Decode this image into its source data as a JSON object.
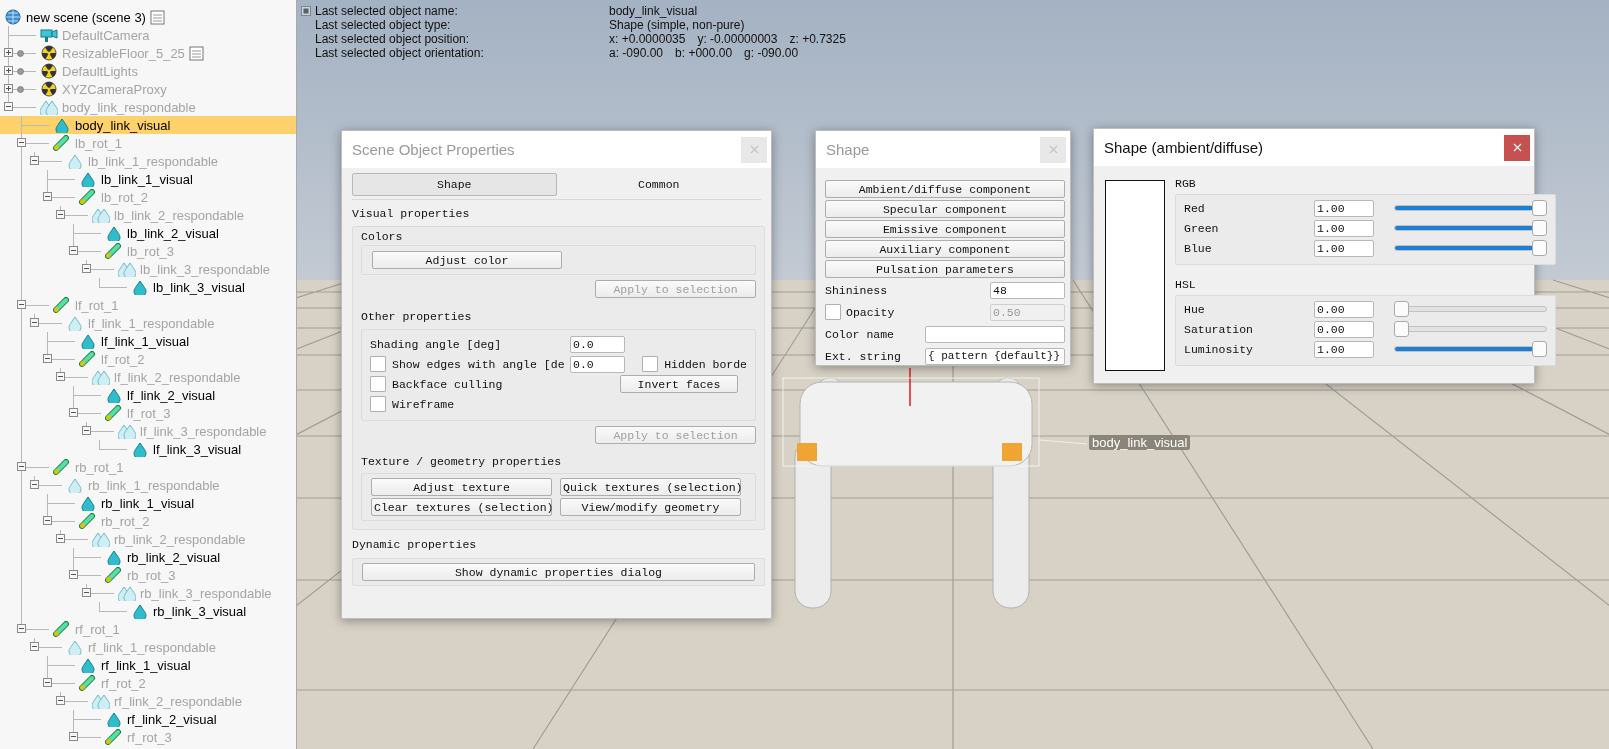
{
  "hierarchy": {
    "items": [
      {
        "label": "new scene (scene 3)",
        "kind": "scene",
        "dim": false,
        "selected": false,
        "has_script": true,
        "children": [
          {
            "label": "DefaultCamera",
            "kind": "camera",
            "dim": true,
            "selected": false
          },
          {
            "label": "ResizableFloor_5_25",
            "kind": "model",
            "dim": true,
            "selected": false,
            "has_script": true,
            "expanded": false
          },
          {
            "label": "DefaultLights",
            "kind": "model",
            "dim": true,
            "selected": false,
            "expanded": false
          },
          {
            "label": "XYZCameraProxy",
            "kind": "model",
            "dim": true,
            "selected": false,
            "expanded": false
          },
          {
            "label": "body_link_respondable",
            "kind": "multi_respondable",
            "dim": true,
            "selected": false,
            "expanded": true,
            "children": [
              {
                "label": "body_link_visual",
                "kind": "shape",
                "dim": false,
                "selected": true
              },
              {
                "label": "lb_rot_1",
                "kind": "joint",
                "dim": true,
                "selected": false,
                "expanded": true,
                "children": [
                  {
                    "label": "lb_link_1_respondable",
                    "kind": "respondable",
                    "dim": true,
                    "selected": false,
                    "expanded": true,
                    "children": [
                      {
                        "label": "lb_link_1_visual",
                        "kind": "shape",
                        "dim": false,
                        "selected": false
                      },
                      {
                        "label": "lb_rot_2",
                        "kind": "joint",
                        "dim": true,
                        "selected": false,
                        "expanded": true,
                        "children": [
                          {
                            "label": "lb_link_2_respondable",
                            "kind": "multi_respondable",
                            "dim": true,
                            "selected": false,
                            "expanded": true,
                            "children": [
                              {
                                "label": "lb_link_2_visual",
                                "kind": "shape",
                                "dim": false,
                                "selected": false
                              },
                              {
                                "label": "lb_rot_3",
                                "kind": "joint",
                                "dim": true,
                                "selected": false,
                                "expanded": true,
                                "children": [
                                  {
                                    "label": "lb_link_3_respondable",
                                    "kind": "multi_respondable",
                                    "dim": true,
                                    "selected": false,
                                    "expanded": true,
                                    "children": [
                                      {
                                        "label": "lb_link_3_visual",
                                        "kind": "shape",
                                        "dim": false,
                                        "selected": false
                                      }
                                    ]
                                  }
                                ]
                              }
                            ]
                          }
                        ]
                      }
                    ]
                  }
                ]
              },
              {
                "label": "lf_rot_1",
                "kind": "joint",
                "dim": true,
                "selected": false,
                "expanded": true,
                "children": [
                  {
                    "label": "lf_link_1_respondable",
                    "kind": "respondable",
                    "dim": true,
                    "selected": false,
                    "expanded": true,
                    "children": [
                      {
                        "label": "lf_link_1_visual",
                        "kind": "shape",
                        "dim": false,
                        "selected": false
                      },
                      {
                        "label": "lf_rot_2",
                        "kind": "joint",
                        "dim": true,
                        "selected": false,
                        "expanded": true,
                        "children": [
                          {
                            "label": "lf_link_2_respondable",
                            "kind": "multi_respondable",
                            "dim": true,
                            "selected": false,
                            "expanded": true,
                            "children": [
                              {
                                "label": "lf_link_2_visual",
                                "kind": "shape",
                                "dim": false,
                                "selected": false
                              },
                              {
                                "label": "lf_rot_3",
                                "kind": "joint",
                                "dim": true,
                                "selected": false,
                                "expanded": true,
                                "children": [
                                  {
                                    "label": "lf_link_3_respondable",
                                    "kind": "multi_respondable",
                                    "dim": true,
                                    "selected": false,
                                    "expanded": true,
                                    "children": [
                                      {
                                        "label": "lf_link_3_visual",
                                        "kind": "shape",
                                        "dim": false,
                                        "selected": false
                                      }
                                    ]
                                  }
                                ]
                              }
                            ]
                          }
                        ]
                      }
                    ]
                  }
                ]
              },
              {
                "label": "rb_rot_1",
                "kind": "joint",
                "dim": true,
                "selected": false,
                "expanded": true,
                "children": [
                  {
                    "label": "rb_link_1_respondable",
                    "kind": "respondable",
                    "dim": true,
                    "selected": false,
                    "expanded": true,
                    "children": [
                      {
                        "label": "rb_link_1_visual",
                        "kind": "shape",
                        "dim": false,
                        "selected": false
                      },
                      {
                        "label": "rb_rot_2",
                        "kind": "joint",
                        "dim": true,
                        "selected": false,
                        "expanded": true,
                        "children": [
                          {
                            "label": "rb_link_2_respondable",
                            "kind": "multi_respondable",
                            "dim": true,
                            "selected": false,
                            "expanded": true,
                            "children": [
                              {
                                "label": "rb_link_2_visual",
                                "kind": "shape",
                                "dim": false,
                                "selected": false
                              },
                              {
                                "label": "rb_rot_3",
                                "kind": "joint",
                                "dim": true,
                                "selected": false,
                                "expanded": true,
                                "children": [
                                  {
                                    "label": "rb_link_3_respondable",
                                    "kind": "multi_respondable",
                                    "dim": true,
                                    "selected": false,
                                    "expanded": true,
                                    "children": [
                                      {
                                        "label": "rb_link_3_visual",
                                        "kind": "shape",
                                        "dim": false,
                                        "selected": false
                                      }
                                    ]
                                  }
                                ]
                              }
                            ]
                          }
                        ]
                      }
                    ]
                  }
                ]
              },
              {
                "label": "rf_rot_1",
                "kind": "joint",
                "dim": true,
                "selected": false,
                "expanded": true,
                "children": [
                  {
                    "label": "rf_link_1_respondable",
                    "kind": "respondable",
                    "dim": true,
                    "selected": false,
                    "expanded": true,
                    "children": [
                      {
                        "label": "rf_link_1_visual",
                        "kind": "shape",
                        "dim": false,
                        "selected": false
                      },
                      {
                        "label": "rf_rot_2",
                        "kind": "joint",
                        "dim": true,
                        "selected": false,
                        "expanded": true,
                        "children": [
                          {
                            "label": "rf_link_2_respondable",
                            "kind": "multi_respondable",
                            "dim": true,
                            "selected": false,
                            "expanded": true,
                            "children": [
                              {
                                "label": "rf_link_2_visual",
                                "kind": "shape",
                                "dim": false,
                                "selected": false
                              },
                              {
                                "label": "rf_rot_3",
                                "kind": "joint",
                                "dim": true,
                                "selected": false,
                                "expanded": true
                              }
                            ]
                          }
                        ]
                      }
                    ]
                  }
                ]
              }
            ]
          }
        ]
      }
    ]
  },
  "info": {
    "rows": [
      {
        "label": "Last selected object name:",
        "values": [
          "body_link_visual"
        ]
      },
      {
        "label": "Last selected object type:",
        "values": [
          "Shape (simple, non-pure)"
        ]
      },
      {
        "label": "Last selected object position:",
        "values": [
          "x: +0.0000035",
          "y: -0.00000003",
          "z: +0.7325"
        ]
      },
      {
        "label": "Last selected object orientation:",
        "values": [
          "a: -090.00",
          "b: +000.00",
          "g: -090.00"
        ]
      }
    ]
  },
  "viewport": {
    "object_label": "body_link_visual"
  },
  "object_properties": {
    "title": "Scene Object Properties",
    "active": false,
    "tabs": [
      {
        "label": "Shape",
        "selected": true
      },
      {
        "label": "Common",
        "selected": false
      }
    ],
    "visual_heading": "Visual properties",
    "colors_heading": "Colors",
    "adjust_color": "Adjust color",
    "apply_colors": {
      "label": "Apply to selection",
      "disabled": true
    },
    "other_heading": "Other properties",
    "shading": {
      "label": "Shading angle [deg]",
      "value": "0.0"
    },
    "show_edges": {
      "label": "Show edges with angle [de",
      "checked": false,
      "value": "0.0"
    },
    "hidden_border": {
      "label": "Hidden borde",
      "checked": false
    },
    "backface": {
      "label": "Backface culling",
      "checked": false
    },
    "invert_faces": "Invert faces",
    "wireframe": {
      "label": "Wireframe",
      "checked": false
    },
    "apply_other": {
      "label": "Apply to selection",
      "disabled": true
    },
    "texture_heading": "Texture / geometry properties",
    "texture_buttons": [
      "Adjust texture",
      "Quick textures (selection)",
      "Clear textures (selection)",
      "View/modify geometry"
    ],
    "dynamic_heading": "Dynamic properties",
    "dynamic_button": "Show dynamic properties dialog"
  },
  "shape_dialog": {
    "title": "Shape",
    "active": false,
    "buttons": [
      "Ambient/diffuse component",
      "Specular component",
      "Emissive component",
      "Auxiliary component",
      "Pulsation parameters"
    ],
    "shininess": {
      "label": "Shininess",
      "value": "48"
    },
    "opacity": {
      "label": "Opacity",
      "checked": false,
      "value": "0.50"
    },
    "color_name": {
      "label": "Color name"
    },
    "ext_string": {
      "label": "Ext. string",
      "value": "{ pattern {default}}"
    }
  },
  "color_dialog": {
    "title": "Shape (ambient/diffuse)",
    "active": true,
    "rgb": {
      "label": "RGB",
      "rows": [
        {
          "name": "Red",
          "value": "1.00",
          "level": 1
        },
        {
          "name": "Green",
          "value": "1.00",
          "level": 1
        },
        {
          "name": "Blue",
          "value": "1.00",
          "level": 1
        }
      ]
    },
    "hsl": {
      "label": "HSL",
      "rows": [
        {
          "name": "Hue",
          "value": "0.00",
          "level": 0
        },
        {
          "name": "Saturation",
          "value": "0.00",
          "level": 0
        },
        {
          "name": "Luminosity",
          "value": "1.00",
          "level": 1
        }
      ]
    }
  }
}
